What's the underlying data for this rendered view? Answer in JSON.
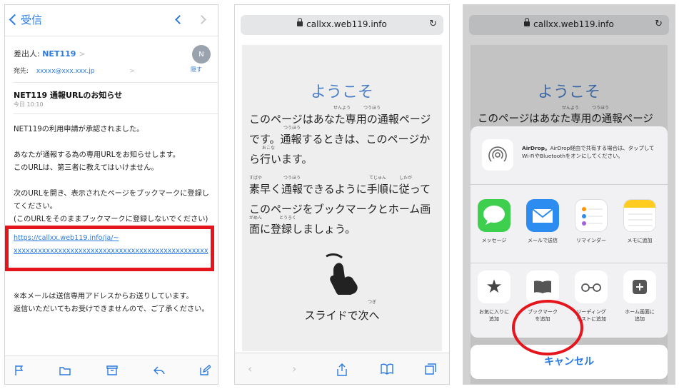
{
  "mail": {
    "back_label": "受信",
    "from_label": "差出人:",
    "from_name": "NET119",
    "to_label": "宛先:",
    "to_address": "xxxxx@xxx.xxx.jp",
    "hide_label": "隠す",
    "avatar_initial": "N",
    "subject": "NET119 通報URLのお知らせ",
    "date": "今日 10:10",
    "body": [
      "NET119の利用申請が承認されました。",
      "あなたが通報する為の専用URLをお知らせします。\nこのURLは、第三者に教えてはいけません。",
      "次のURLを開き、表示されたページをブックマークに登録してください。\n(このURLをそのままブックマークに登録しないでください)"
    ],
    "link_line1": "https://callxx.web119.info/ja/~",
    "link_line2": "xxxxxxxxxxxxxxxxxxxxxxxxxxxxxxxxxxxxxxxxxxxxxxxx",
    "footer": "※本メールは送信専用アドレスからお送りしています。\n返信いただいてもお受けできませんので、ご了承ください。"
  },
  "safari": {
    "url": "callxx.web119.info",
    "welcome": "ようこそ",
    "para1": "このページはあなた専用の通報ページです。通報するときは、このページから行います。",
    "para2": "素早く通報できるように手順に従ってこのページをブックマークとホーム画面に登録しましょう。",
    "ruby_senyou": "せんよう",
    "ruby_tsuhou": "つうほう",
    "ruby_okona": "おこな",
    "ruby_subaya": "すばや",
    "ruby_tejun": "てじゅん",
    "ruby_shitaga": "したが",
    "ruby_gamen": "がめん",
    "ruby_touroku": "とうろく",
    "ruby_tsugi": "つぎ",
    "slide_next": "スライドで次へ"
  },
  "share": {
    "url": "callxx.web119.info",
    "welcome": "ようこそ",
    "para1_visible": "このページはあなた専用の通報ページ",
    "airdrop_title": "AirDrop。",
    "airdrop_text": "AirDrop経由で共有する場合は、タップしてWi-FiやBluetoothをオンにしてください。",
    "apps": [
      {
        "label": "メッセージ",
        "color": "#3fcf4f"
      },
      {
        "label": "メールで送信",
        "color": "#2d8cf0"
      },
      {
        "label": "リマインダー",
        "color": "#ffffff"
      },
      {
        "label": "メモに追加",
        "color": "#ffffff"
      }
    ],
    "actions": [
      {
        "label": "お気に入りに\n追加",
        "icon": "star-icon"
      },
      {
        "label": "ブックマーク\nを追加",
        "icon": "book-icon"
      },
      {
        "label": "リーディング\nリストに追加",
        "icon": "glasses-icon"
      },
      {
        "label": "ホーム画面に\n追加",
        "icon": "plus-icon"
      }
    ],
    "partial_label": "ペ",
    "cancel": "キャンセル",
    "highlight_color": "#e4151c"
  }
}
